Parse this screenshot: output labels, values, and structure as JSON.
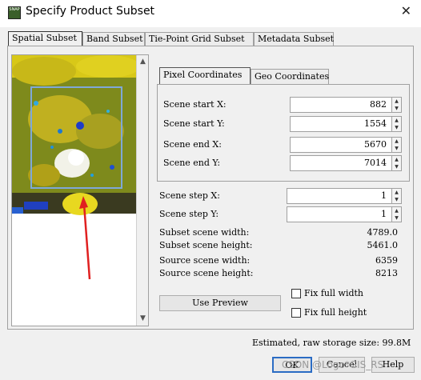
{
  "window": {
    "title": "Specify Product Subset",
    "icon_text": "SNAP",
    "close_glyph": "✕"
  },
  "tabs": [
    {
      "label": "Spatial Subset",
      "active": true
    },
    {
      "label": "Band Subset"
    },
    {
      "label": "Tie-Point Grid Subset"
    },
    {
      "label": "Metadata Subset"
    }
  ],
  "coord_tabs": [
    {
      "label": "Pixel Coordinates",
      "active": true
    },
    {
      "label": "Geo Coordinates"
    }
  ],
  "fields": {
    "scene_start_x": {
      "label": "Scene start X:",
      "value": "882"
    },
    "scene_start_y": {
      "label": "Scene start Y:",
      "value": "1554"
    },
    "scene_end_x": {
      "label": "Scene end X:",
      "value": "5670"
    },
    "scene_end_y": {
      "label": "Scene end Y:",
      "value": "7014"
    },
    "scene_step_x": {
      "label": "Scene step X:",
      "value": "1"
    },
    "scene_step_y": {
      "label": "Scene step Y:",
      "value": "1"
    }
  },
  "info": {
    "subset_width": {
      "label": "Subset scene width:",
      "value": "4789.0"
    },
    "subset_height": {
      "label": "Subset scene height:",
      "value": "5461.0"
    },
    "source_width": {
      "label": "Source scene width:",
      "value": "6359"
    },
    "source_height": {
      "label": "Source scene height:",
      "value": "8213"
    }
  },
  "use_preview_label": "Use Preview",
  "fix_full_width": "Fix full width",
  "fix_full_height": "Fix full height",
  "storage_text": "Estimated, raw storage size: 99.8M",
  "buttons": {
    "ok": "OK",
    "cancel": "Cancel",
    "help": "Help"
  },
  "watermark": "CSDN @Logo*GIS_RS",
  "colors": {
    "thumb_green": "#808c1c",
    "thumb_yellow": "#e0d020",
    "roi_frame": "#7fa8d8",
    "annotation_arrow": "#e02020"
  }
}
